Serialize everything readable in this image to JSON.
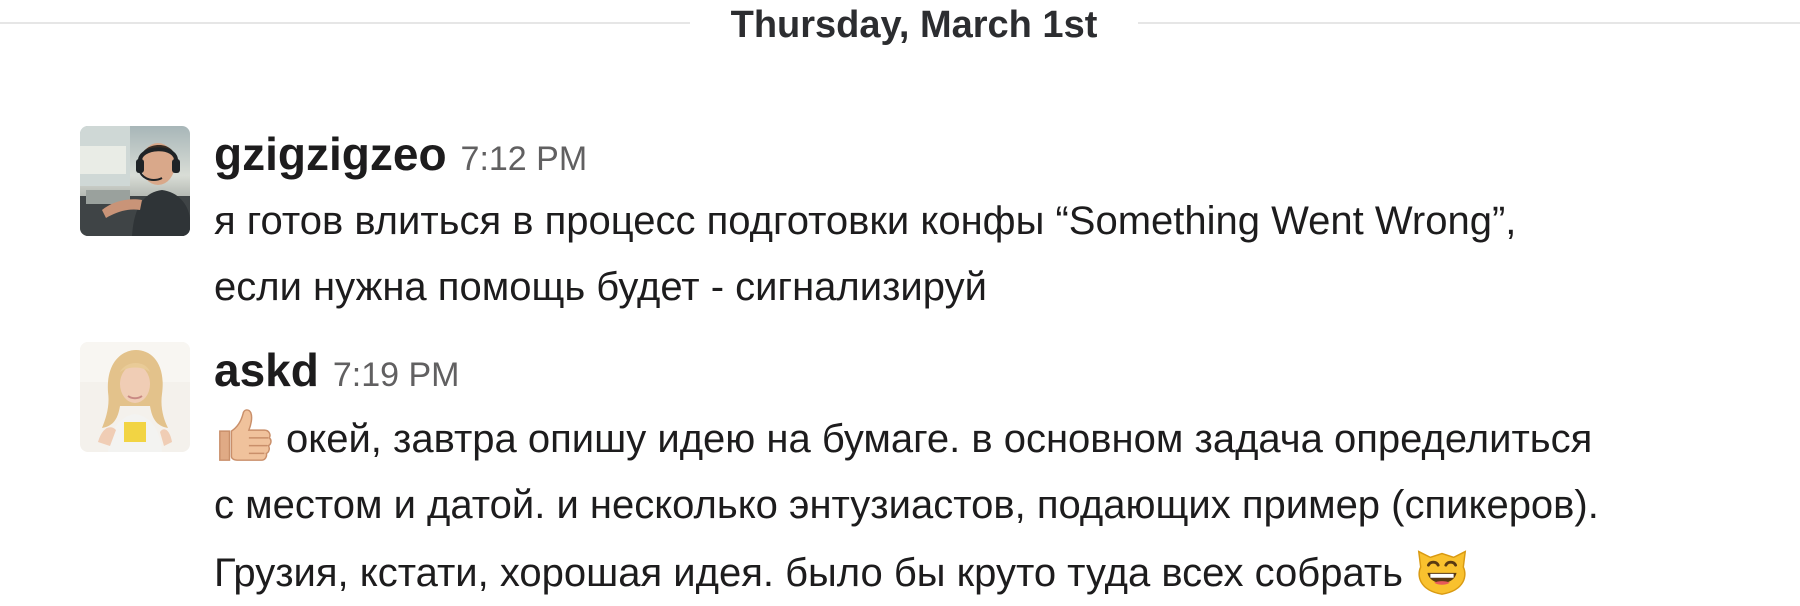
{
  "day_divider": {
    "label": "Thursday, March 1st"
  },
  "messages": [
    {
      "author": "gzigzigzeo",
      "time": "7:12 PM",
      "avatar_icon": "avatar-photo-man-headset",
      "lines": [
        "я готов влиться в процесс подготовки конфы “Something Went Wrong”,",
        "если нужна помощь будет - сигнализируй"
      ]
    },
    {
      "author": "askd",
      "time": "7:19 PM",
      "avatar_icon": "avatar-photo-woman-blonde",
      "leading_emoji": "thumbs-up-icon",
      "trailing_emoji": "grinning-cat-icon",
      "lines": [
        "окей, завтра опишу идею на бумаге. в основном задача определиться",
        "с местом и датой. и несколько энтузиастов, подающих пример (спикеров).",
        "Грузия, кстати, хорошая идея. было бы круто туда всех собрать"
      ]
    }
  ],
  "colors": {
    "text": "#1d1c1d",
    "timestamp": "#616061",
    "divider_line": "#e6e6e6",
    "divider_text": "#2c2d30"
  }
}
